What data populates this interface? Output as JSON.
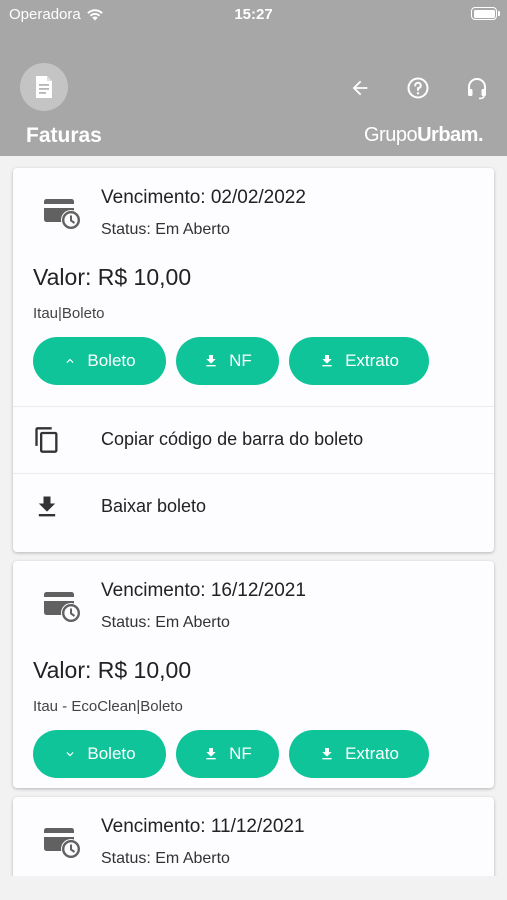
{
  "status_bar": {
    "carrier": "Operadora",
    "time": "15:27"
  },
  "header": {
    "title": "Faturas",
    "brand_prefix": "Grupo",
    "brand_suffix": "Urbam."
  },
  "invoices": [
    {
      "due": "Vencimento: 02/02/2022",
      "status": "Status: Em Aberto",
      "value": "Valor: R$ 10,00",
      "method": "Itau|Boleto",
      "buttons": {
        "boleto": "Boleto",
        "nf": "NF",
        "extrato": "Extrato"
      },
      "expanded": true,
      "actions": {
        "copy": "Copiar código de barra do boleto",
        "download": "Baixar boleto"
      }
    },
    {
      "due": "Vencimento: 16/12/2021",
      "status": "Status: Em Aberto",
      "value": "Valor: R$ 10,00",
      "method": "Itau - EcoClean|Boleto",
      "buttons": {
        "boleto": "Boleto",
        "nf": "NF",
        "extrato": "Extrato"
      },
      "expanded": false
    },
    {
      "due": "Vencimento: 11/12/2021",
      "status": "Status: Em Aberto"
    }
  ],
  "colors": {
    "header_bg": "#a7a7a7",
    "accent": "#10c49a",
    "card_bg": "#fdfcfe"
  },
  "icons": [
    "document-icon",
    "back-arrow-icon",
    "help-icon",
    "headset-icon",
    "invoice-clock-icon",
    "chevron-up-icon",
    "chevron-down-icon",
    "download-icon",
    "copy-icon"
  ]
}
